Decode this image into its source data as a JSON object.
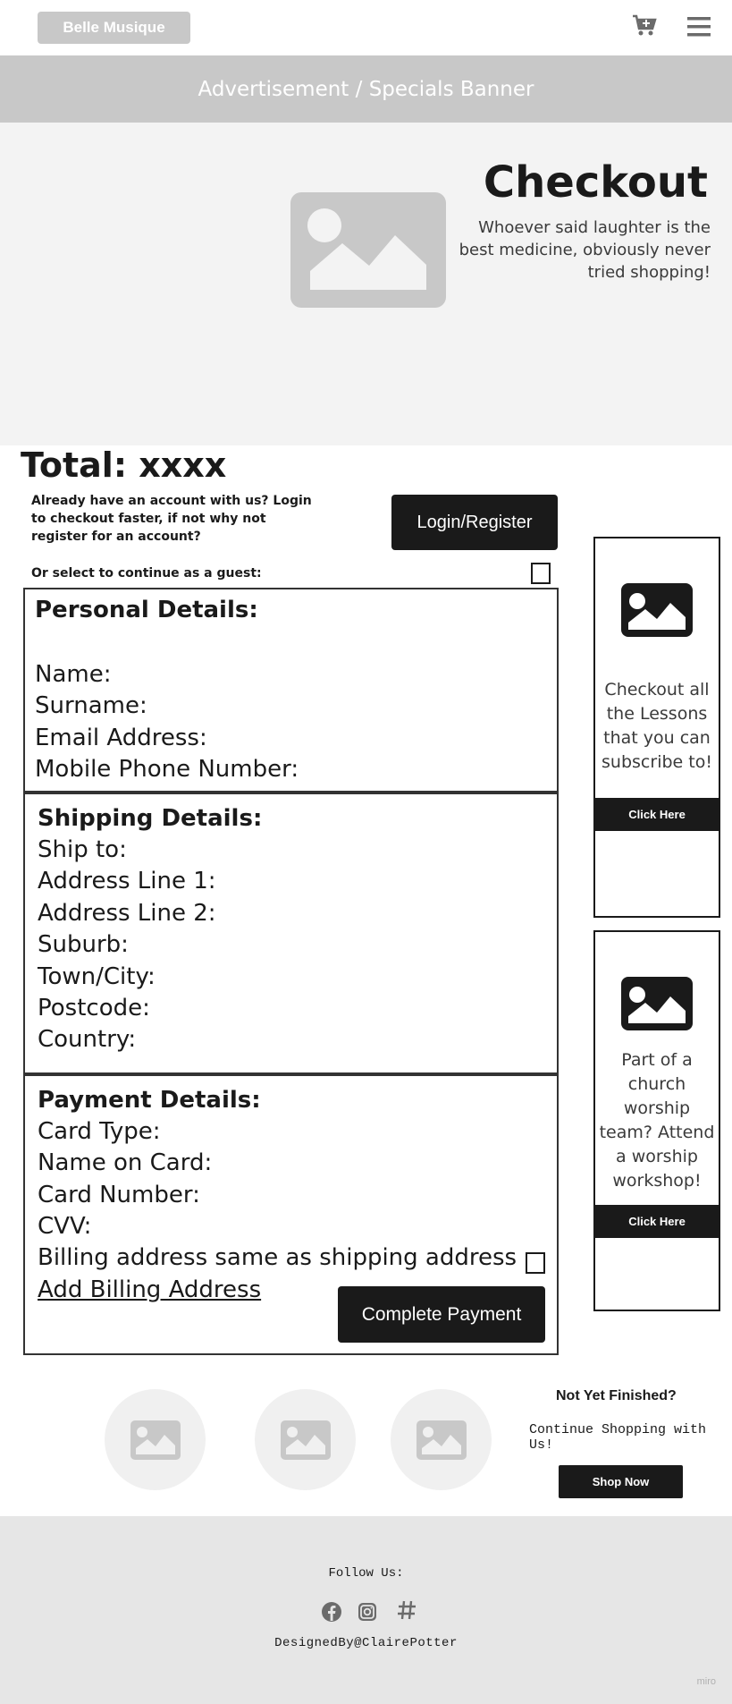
{
  "header": {
    "logo_text": "Belle Musique",
    "cart_icon": "cart-plus-icon",
    "menu_icon": "hamburger-menu-icon"
  },
  "banner": {
    "text": "Advertisement / Specials Banner"
  },
  "hero": {
    "title": "Checkout",
    "subtitle": "Whoever said laughter is the best medicine, obviously never tried shopping!",
    "image_icon": "image-placeholder-icon"
  },
  "checkout": {
    "total": "Total: xxxx",
    "login_prompt": "Already have an account with us? Login to checkout faster, if not why not register for an account?",
    "login_button": "Login/Register",
    "guest_label": "Or select to continue as a guest:"
  },
  "personal": {
    "title": "Personal Details:",
    "fields": [
      "Name:",
      "Surname:",
      "Email Address:",
      "Mobile Phone Number:"
    ]
  },
  "shipping": {
    "title": "Shipping Details:",
    "fields": [
      "Ship to:",
      "Address Line 1:",
      "Address Line 2:",
      "Suburb:",
      "Town/City:",
      "Postcode:",
      "Country:"
    ]
  },
  "payment": {
    "title": "Payment Details:",
    "fields": [
      "Card Type:",
      "Name on Card:",
      "Card Number:",
      "CVV:"
    ],
    "billing_same": "Billing address same as shipping address",
    "add_billing": "Add Billing Address",
    "complete_button": "Complete Payment"
  },
  "side_ads": [
    {
      "text": "Checkout all the Lessons that you can subscribe to!",
      "button": "Click Here"
    },
    {
      "text": "Part of a church worship team? Attend a worship workshop!",
      "button": "Click Here"
    }
  ],
  "continue": {
    "title": "Not Yet Finished?",
    "text": "Continue Shopping with Us!",
    "button": "Shop Now"
  },
  "footer": {
    "follow": "Follow Us:",
    "social_icons": [
      "facebook-icon",
      "instagram-icon",
      "hashtag-icon"
    ],
    "designed_by": "DesignedBy@ClairePotter"
  },
  "watermark": "miro"
}
